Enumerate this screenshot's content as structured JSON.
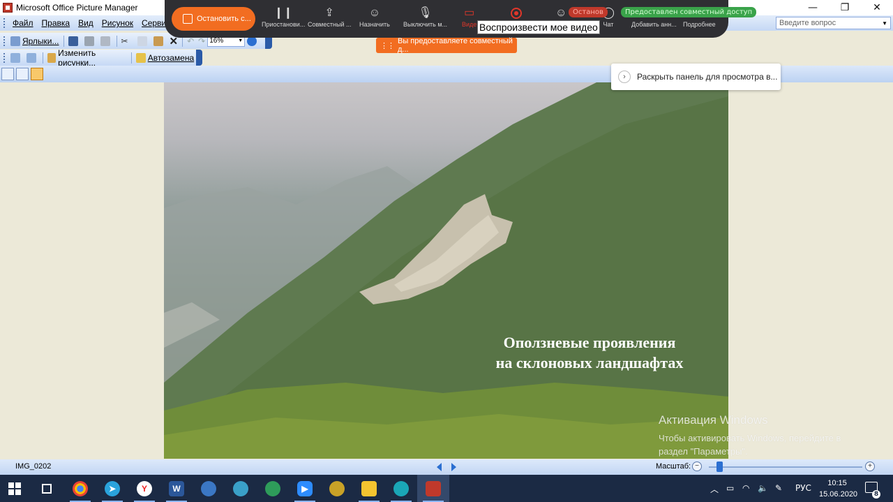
{
  "window": {
    "title": "Microsoft Office Picture Manager",
    "minimize_glyph": "—",
    "restore_glyph": "❐",
    "close_glyph": "✕"
  },
  "menu": {
    "items": [
      "Файл",
      "Правка",
      "Вид",
      "Рисунок",
      "Сервис"
    ],
    "help_placeholder": "Введите вопрос"
  },
  "toolbar": {
    "shortcuts_label": "Ярлыки...",
    "zoom_value": "16%",
    "edit_pictures_label": "Изменить рисунки...",
    "autocorrect_label": "Автозамена"
  },
  "zoom_overlay": {
    "stop_share_label": "Остановить с...",
    "pause_label": "Приостанови...",
    "share_label": "Совместный ...",
    "assign_label": "Назначить",
    "mute_label": "Выключить м...",
    "video_label": "Виде",
    "record_label": "",
    "participants_label": "",
    "chat_label": "Чат",
    "annotate_label": "Добавить анн...",
    "more_label": "Подробнее",
    "video_tooltip": "Воспроизвести мое видео",
    "stop_pill": "Останов",
    "share_pill": "Предоставлен совместный доступ",
    "notice": "Вы предоставляете совместный д...",
    "expand_panel": "Раскрыть панель для просмотра в..."
  },
  "picture": {
    "caption_line1": "Оползневые проявления",
    "caption_line2": "на склоновых ландшафтах"
  },
  "activation": {
    "heading": "Активация Windows",
    "line1": "Чтобы активировать Windows, перейдите в",
    "line2": "раздел \"Параметры\"."
  },
  "statusbar": {
    "filename": "IMG_0202",
    "zoom_label": "Масштаб:",
    "zoom_level": 0.07
  },
  "taskbar": {
    "language": "РУС",
    "time": "10:15",
    "date": "15.06.2020",
    "notification_count": "8",
    "apps": [
      "windows-start",
      "task-view",
      "chrome",
      "telegram",
      "yandex-browser",
      "word",
      "google-earth",
      "search-app",
      "globe-app",
      "zoom",
      "earth-app",
      "file-explorer",
      "browser-app",
      "picture-manager"
    ]
  },
  "colors": {
    "accent_orange": "#f26d21",
    "zoom_bar": "#2f2f33",
    "office_blue": "#c5d8f4",
    "taskbar": "#1b2a44"
  }
}
